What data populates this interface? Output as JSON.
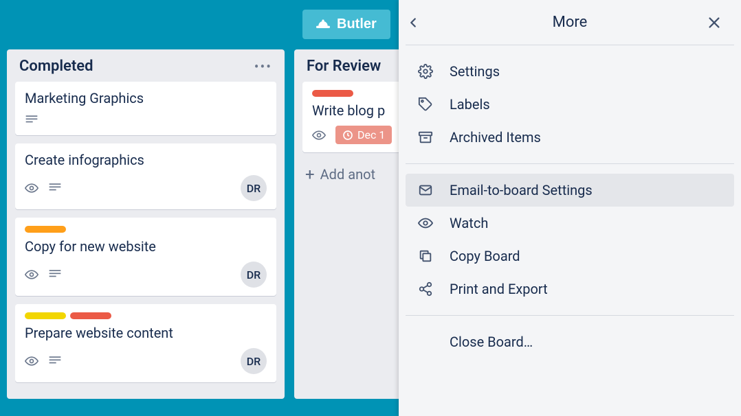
{
  "butler_label": "Butler",
  "lists": {
    "completed": {
      "title": "Completed",
      "cards": [
        {
          "title": "Marketing Graphics"
        },
        {
          "title": "Create infographics",
          "member": "DR"
        },
        {
          "title": "Copy for new website",
          "member": "DR"
        },
        {
          "title": "Prepare website content",
          "member": "DR"
        }
      ]
    },
    "review": {
      "title": "For Review",
      "card_title": "Write blog p",
      "due_text": "Dec 1",
      "add_text": "Add anot"
    }
  },
  "panel": {
    "title": "More",
    "items": {
      "settings": "Settings",
      "labels": "Labels",
      "archived": "Archived Items",
      "email": "Email-to-board Settings",
      "watch": "Watch",
      "copy": "Copy Board",
      "print": "Print and Export",
      "close": "Close Board…"
    }
  }
}
